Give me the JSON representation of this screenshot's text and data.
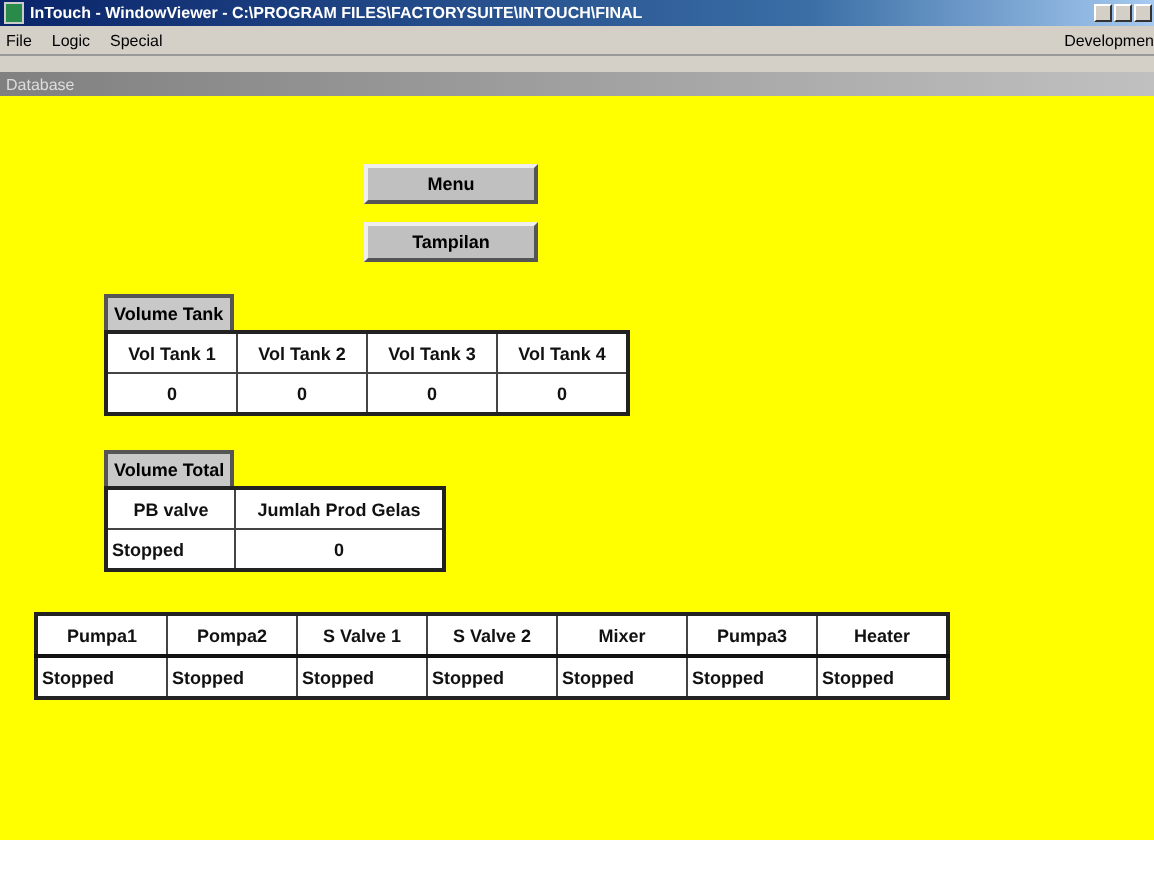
{
  "window": {
    "title": "InTouch - WindowViewer - C:\\PROGRAM FILES\\FACTORYSUITE\\INTOUCH\\FINAL"
  },
  "menu": [
    "File",
    "Logic",
    "Special"
  ],
  "menu_right": "Developmen",
  "inner_window": {
    "title": "Database"
  },
  "buttons": [
    "Menu",
    "Tampilan"
  ],
  "volume_tank": {
    "label": "Volume Tank",
    "columns": [
      "Vol Tank 1",
      "Vol Tank 2",
      "Vol Tank 3",
      "Vol Tank 4"
    ],
    "values": [
      "0",
      "0",
      "0",
      "0"
    ]
  },
  "volume_total": {
    "label": "Volume Total",
    "columns": [
      "PB valve",
      "Jumlah Prod Gelas"
    ],
    "values": [
      "Stopped",
      "0"
    ]
  },
  "devices": {
    "columns": [
      "Pumpa1",
      "Pompa2",
      "S Valve 1",
      "S Valve 2",
      "Mixer",
      "Pumpa3",
      "Heater"
    ],
    "values": [
      "Stopped",
      "Stopped",
      "Stopped",
      "Stopped",
      "Stopped",
      "Stopped",
      "Stopped"
    ]
  }
}
